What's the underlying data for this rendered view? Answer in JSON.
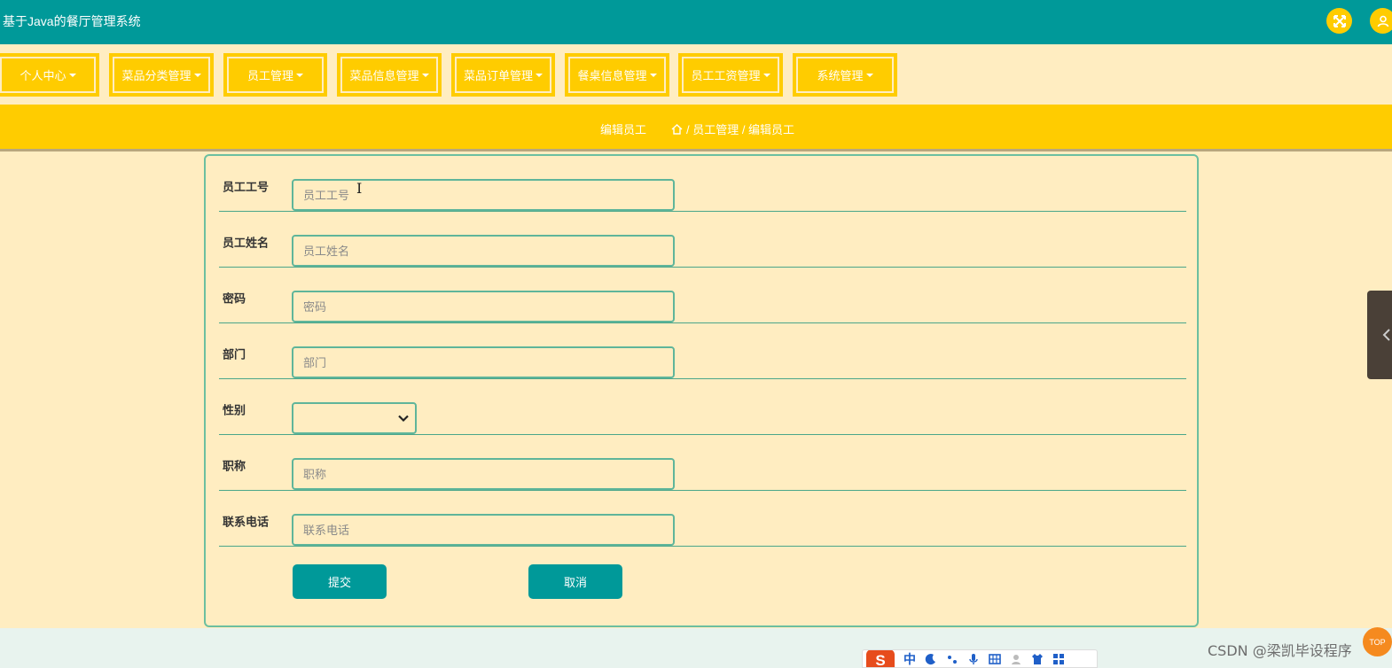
{
  "app": {
    "title": "基于Java的餐厅管理系统"
  },
  "header_icons": [
    "fullscreen-icon",
    "user-icon"
  ],
  "nav": {
    "items": [
      {
        "label": "个人中心"
      },
      {
        "label": "菜品分类管理"
      },
      {
        "label": "员工管理"
      },
      {
        "label": "菜品信息管理"
      },
      {
        "label": "菜品订单管理"
      },
      {
        "label": "餐桌信息管理"
      },
      {
        "label": "员工工资管理"
      },
      {
        "label": "系统管理"
      }
    ]
  },
  "breadcrumb": {
    "title": "编辑员工",
    "path": "/ 员工管理 / 编辑员工"
  },
  "form": {
    "fields": [
      {
        "label": "员工工号",
        "placeholder": "员工工号",
        "value": ""
      },
      {
        "label": "员工姓名",
        "placeholder": "员工姓名",
        "value": ""
      },
      {
        "label": "密码",
        "placeholder": "密码",
        "value": ""
      },
      {
        "label": "部门",
        "placeholder": "部门",
        "value": ""
      },
      {
        "label": "性别",
        "type": "select",
        "value": ""
      },
      {
        "label": "职称",
        "placeholder": "职称",
        "value": ""
      },
      {
        "label": "联系电话",
        "placeholder": "联系电话",
        "value": ""
      }
    ],
    "submit_label": "提交",
    "cancel_label": "取消"
  },
  "watermark": "CSDN @梁凯毕设程序",
  "top_button": "TOP",
  "ime": {
    "logo": "S",
    "mode": "中"
  },
  "colors": {
    "header": "#009999",
    "accent": "#ffcc00",
    "background": "#ffedc1",
    "button": "#009999"
  }
}
